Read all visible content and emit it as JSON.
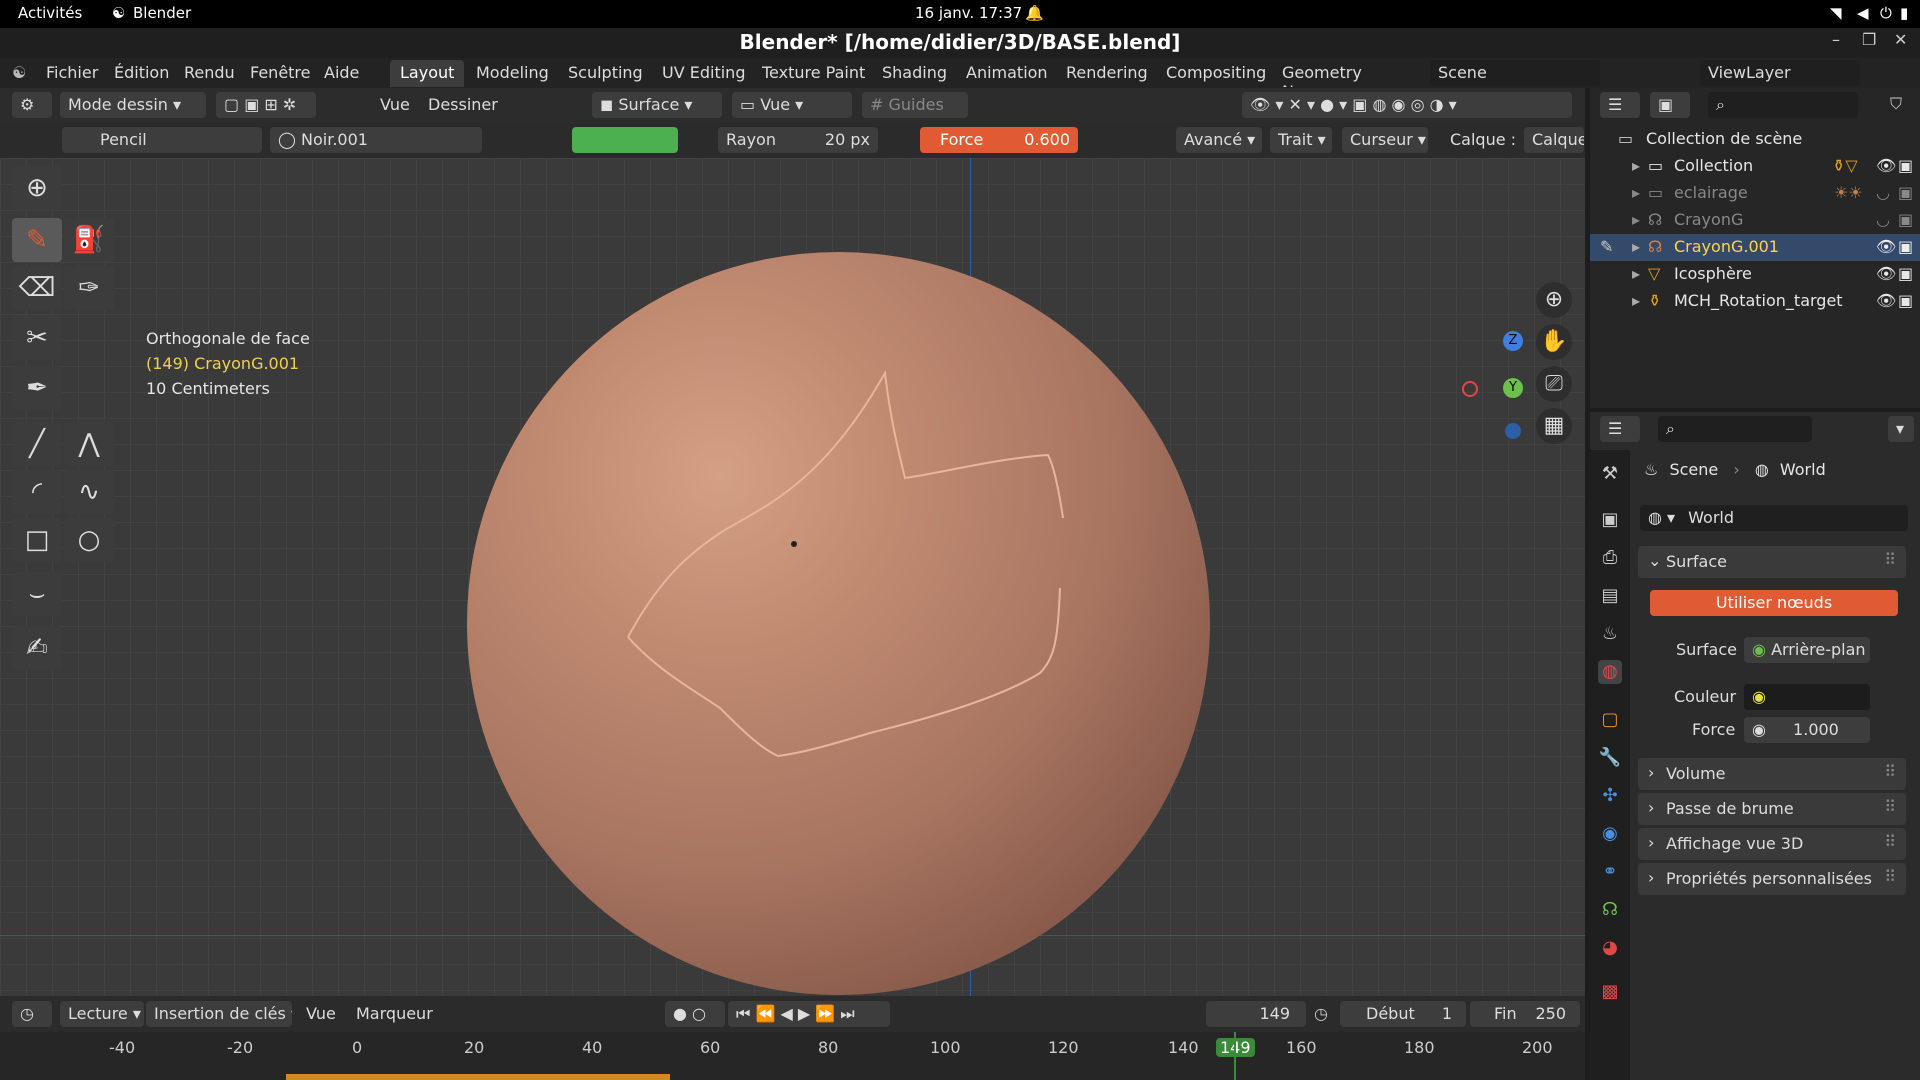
{
  "system": {
    "activities": "Activités",
    "app": "Blender",
    "clock": "16 janv.  17:37"
  },
  "window": {
    "title": "Blender* [/home/didier/3D/BASE.blend]"
  },
  "menubar": {
    "menus": [
      "Fichier",
      "Édition",
      "Rendu",
      "Fenêtre",
      "Aide"
    ],
    "workspaces": [
      "Layout",
      "Modeling",
      "Sculpting",
      "UV Editing",
      "Texture Paint",
      "Shading",
      "Animation",
      "Rendering",
      "Compositing",
      "Geometry Nc"
    ],
    "scene": "Scene",
    "viewlayer": "ViewLayer"
  },
  "header": {
    "mode": "Mode dessin",
    "vue": "Vue",
    "dessiner": "Dessiner",
    "surface": "Surface",
    "vue2": "Vue",
    "guides": "Guides"
  },
  "toolsettings": {
    "brush": "Pencil",
    "material": "Noir.001",
    "rayon_label": "Rayon",
    "rayon_value": "20 px",
    "force_label": "Force",
    "force_value": "0.600",
    "avance": "Avancé",
    "trait": "Trait",
    "curseur": "Curseur",
    "calque_label": "Calque :",
    "calque_value": "Calque"
  },
  "viewport": {
    "view_name": "Orthogonale de face",
    "object": "(149) CrayonG.001",
    "scale": "10 Centimeters"
  },
  "gizmo": {
    "z": "Z",
    "y": "Y",
    "x": "X"
  },
  "timeline": {
    "lecture": "Lecture",
    "insertion": "Insertion de clés",
    "vue": "Vue",
    "marqueur": "Marqueur",
    "current_frame": "149",
    "debut_label": "Début",
    "debut_value": "1",
    "fin_label": "Fin",
    "fin_value": "250",
    "ticks": [
      "-40",
      "-20",
      "0",
      "20",
      "40",
      "60",
      "80",
      "100",
      "120",
      "140",
      "149",
      "160",
      "180",
      "200"
    ]
  },
  "outliner": {
    "root": "Collection de scène",
    "items": [
      {
        "name": "Collection",
        "badge": "2"
      },
      {
        "name": "eclairage",
        "badge": "3"
      },
      {
        "name": "CrayonG",
        "badge": ""
      },
      {
        "name": "CrayonG.001",
        "badge": ""
      },
      {
        "name": "Icosphère",
        "badge": ""
      },
      {
        "name": "MCH_Rotation_target",
        "badge": ""
      }
    ]
  },
  "properties": {
    "breadcrumb_scene": "Scene",
    "breadcrumb_world": "World",
    "world_name": "World",
    "surface_panel": "Surface",
    "use_nodes": "Utiliser nœuds",
    "surface_label": "Surface",
    "surface_value": "Arrière-plan",
    "couleur_label": "Couleur",
    "force_label": "Force",
    "force_value": "1.000",
    "panels": [
      "Volume",
      "Passe de brume",
      "Affichage vue 3D",
      "Propriétés personnalisées"
    ]
  },
  "colors": {
    "accent": "#e05a33",
    "selected_text": "#f0d050",
    "object_active": "#ffd44a"
  }
}
